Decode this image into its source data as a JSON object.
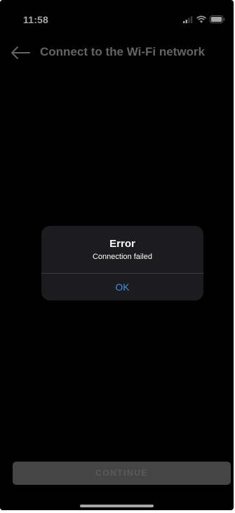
{
  "status_bar": {
    "time": "11:58",
    "icons": [
      "cellular-signal-icon",
      "wifi-icon",
      "battery-icon"
    ]
  },
  "nav": {
    "back_icon": "arrow-left-icon",
    "title": "Connect to the Wi-Fi network"
  },
  "dialog": {
    "title": "Error",
    "message": "Connection failed",
    "ok_label": "OK",
    "accent_color": "#3d8fe0"
  },
  "footer": {
    "continue_label": "CONTINUE",
    "continue_enabled": false
  },
  "colors": {
    "background": "#000000",
    "dialog_background": "#1c1c1e",
    "button_disabled": "#6b6b6b"
  }
}
